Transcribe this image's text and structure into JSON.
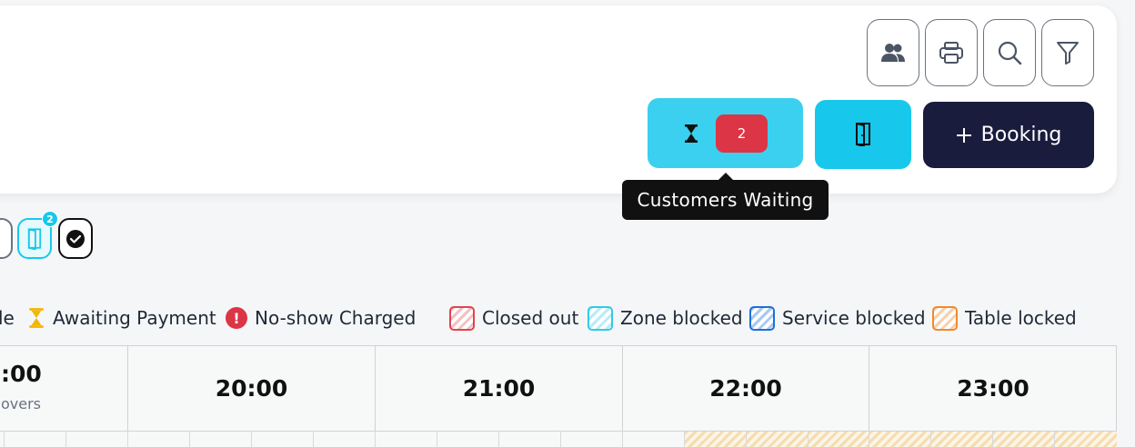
{
  "header": {
    "toolbar_icons": [
      "people-icon",
      "printer-icon",
      "search-icon",
      "filter-icon"
    ],
    "waiting_count": "2",
    "booking_label": "Booking",
    "tooltip": "Customers Waiting"
  },
  "quick_filters": {
    "door_badge": "2"
  },
  "legend": {
    "partial_text": "le",
    "items": [
      {
        "label": "Awaiting Payment",
        "icon": "hourglass-icon"
      },
      {
        "label": "No-show Charged",
        "icon": "exclamation-icon",
        "glyph": "!"
      },
      {
        "label": "Closed out",
        "color": "#e3424d"
      },
      {
        "label": "Zone blocked",
        "color": "#33c9e8"
      },
      {
        "label": "Service blocked",
        "color": "#1d6fd8"
      },
      {
        "label": "Table locked",
        "color": "#f08a2e"
      }
    ]
  },
  "timeline": {
    "partial_time": ":00",
    "partial_sub": "overs",
    "hours": [
      "20:00",
      "21:00",
      "22:00",
      "23:00"
    ]
  }
}
